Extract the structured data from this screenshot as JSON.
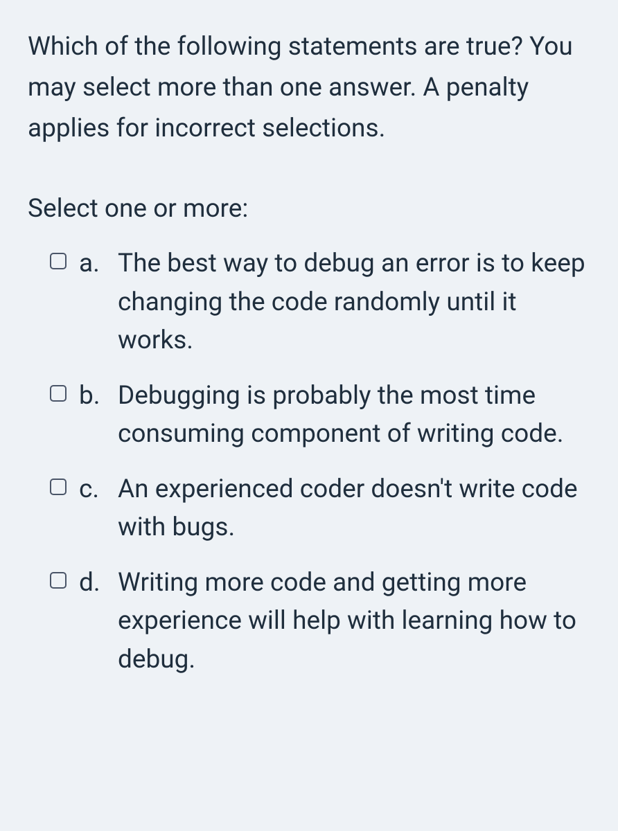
{
  "question": {
    "text": "Which of the following statements are true? You may select more than one answer. A penalty applies for incorrect selections.",
    "prompt": "Select one or more:",
    "options": [
      {
        "letter": "a.",
        "text": "The best way to debug an error is to keep changing the code randomly until it works."
      },
      {
        "letter": "b.",
        "text": "Debugging is probably the most time consuming component of writing code."
      },
      {
        "letter": "c.",
        "text": "An experienced coder doesn't write code with bugs."
      },
      {
        "letter": "d.",
        "text": "Writing more code and getting more experience will help with learning how to debug."
      }
    ]
  }
}
